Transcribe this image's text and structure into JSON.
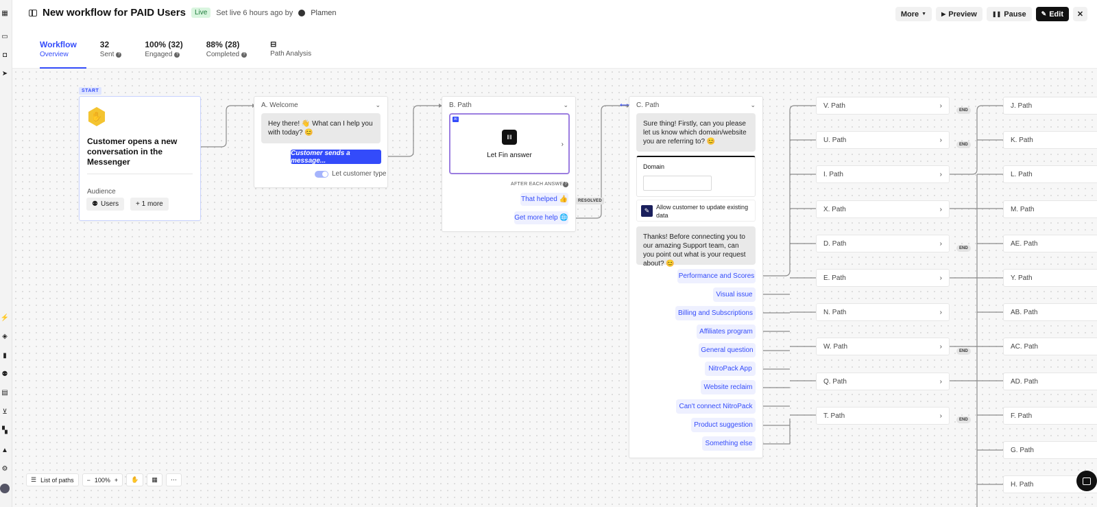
{
  "header": {
    "title": "New workflow for PAID Users",
    "status": "Live",
    "meta": "Set live 6 hours ago by",
    "owner": "Plamen",
    "buttons": {
      "more": "More",
      "preview": "Preview",
      "pause": "Pause",
      "edit": "Edit"
    }
  },
  "tabs": [
    {
      "top": "Workflow",
      "bottom": "Overview"
    },
    {
      "top": "32",
      "bottom": "Sent"
    },
    {
      "top": "100% (32)",
      "bottom": "Engaged"
    },
    {
      "top": "88% (28)",
      "bottom": "Completed"
    },
    {
      "top": "",
      "bottom": "Path Analysis"
    }
  ],
  "start": {
    "badge": "START",
    "title": "Customer opens a new conversation in the Messenger",
    "audience_label": "Audience",
    "audience_pills": [
      "Users",
      "+ 1 more"
    ]
  },
  "welcome": {
    "header": "A. Welcome",
    "message": "Hey there! 👋 What can I help you with today? 😊",
    "cta": "Customer sends a message...",
    "toggle_label": "Let customer type"
  },
  "path_b": {
    "header": "B. Path",
    "ai_tag": "AI",
    "fin_label": "Let Fin answer",
    "after_label": "AFTER EACH ANSWER",
    "replies": [
      "That helped 👍",
      "Get more help 🌐"
    ],
    "resolved": "RESOLVED"
  },
  "path_c": {
    "header": "C. Path",
    "message1": "Sure thing! Firstly, can you please let us know which domain/website you are referring to? 😊",
    "domain_label": "Domain",
    "allow_label": "Allow customer to update existing data",
    "message2": "Thanks! Before connecting you to our amazing Support team, can you point out what is your request about? 😊",
    "options": [
      "Performance and Scores",
      "Visual issue",
      "Billing and Subscriptions",
      "Affiliates program",
      "General question",
      "NitroPack App",
      "Website reclaim",
      "Can't connect NitroPack",
      "Product suggestion",
      "Something else"
    ]
  },
  "paths_col1": [
    {
      "label": "V. Path",
      "end": true
    },
    {
      "label": "U. Path",
      "end": true
    },
    {
      "label": "I. Path",
      "end": false
    },
    {
      "label": "X. Path",
      "end": false
    },
    {
      "label": "D. Path",
      "end": true
    },
    {
      "label": "E. Path",
      "end": false
    },
    {
      "label": "N. Path",
      "end": false
    },
    {
      "label": "W. Path",
      "end": true
    },
    {
      "label": "Q. Path",
      "end": false
    },
    {
      "label": "T. Path",
      "end": true
    }
  ],
  "end_label": "END",
  "paths_col2": [
    "J. Path",
    "K. Path",
    "L. Path",
    "M. Path",
    "AE. Path",
    "Y. Path",
    "AB. Path",
    "AC. Path",
    "AD. Path",
    "F. Path",
    "G. Path",
    "H. Path"
  ],
  "toolbar": {
    "list_paths": "List of paths",
    "zoom": "100%"
  }
}
